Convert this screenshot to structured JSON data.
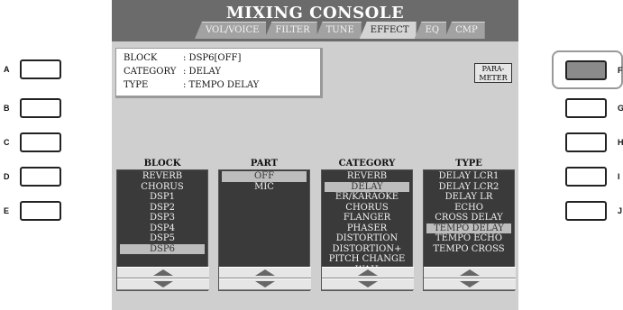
{
  "title": "MIXING CONSOLE",
  "tabs": [
    "VOL/VOICE",
    "FILTER",
    "TUNE",
    "EFFECT",
    "EQ",
    "CMP"
  ],
  "active_tab": "EFFECT",
  "info": {
    "block_label": "BLOCK",
    "block_value": ": DSP6[OFF]",
    "category_label": "CATEGORY",
    "category_value": ": DELAY",
    "type_label": "TYPE",
    "type_value": ": TEMPO DELAY"
  },
  "parameter_button": "PARA-\nMETER",
  "left_buttons": [
    "A",
    "B",
    "C",
    "D",
    "E"
  ],
  "right_buttons": [
    "F",
    "G",
    "H",
    "I",
    "J"
  ],
  "active_button": "F",
  "columns": [
    {
      "header": "BLOCK",
      "items": [
        "REVERB",
        "CHORUS",
        "DSP1",
        "DSP2",
        "DSP3",
        "DSP4",
        "DSP5",
        "DSP6"
      ],
      "selected": "DSP6"
    },
    {
      "header": "PART",
      "items": [
        "OFF",
        "MIC"
      ],
      "selected": "OFF"
    },
    {
      "header": "CATEGORY",
      "items": [
        "REVERB",
        "DELAY",
        "ER/KARAOKE",
        "CHORUS",
        "FLANGER",
        "PHASER",
        "DISTORTION",
        "DISTORTION+",
        "PITCH CHANGE",
        "WAH"
      ],
      "selected": "DELAY"
    },
    {
      "header": "TYPE",
      "items": [
        "DELAY LCR1",
        "DELAY LCR2",
        "DELAY LR",
        "ECHO",
        "CROSS DELAY",
        "TEMPO DELAY",
        "TEMPO ECHO",
        "TEMPO CROSS"
      ],
      "selected": "TEMPO DELAY"
    }
  ]
}
